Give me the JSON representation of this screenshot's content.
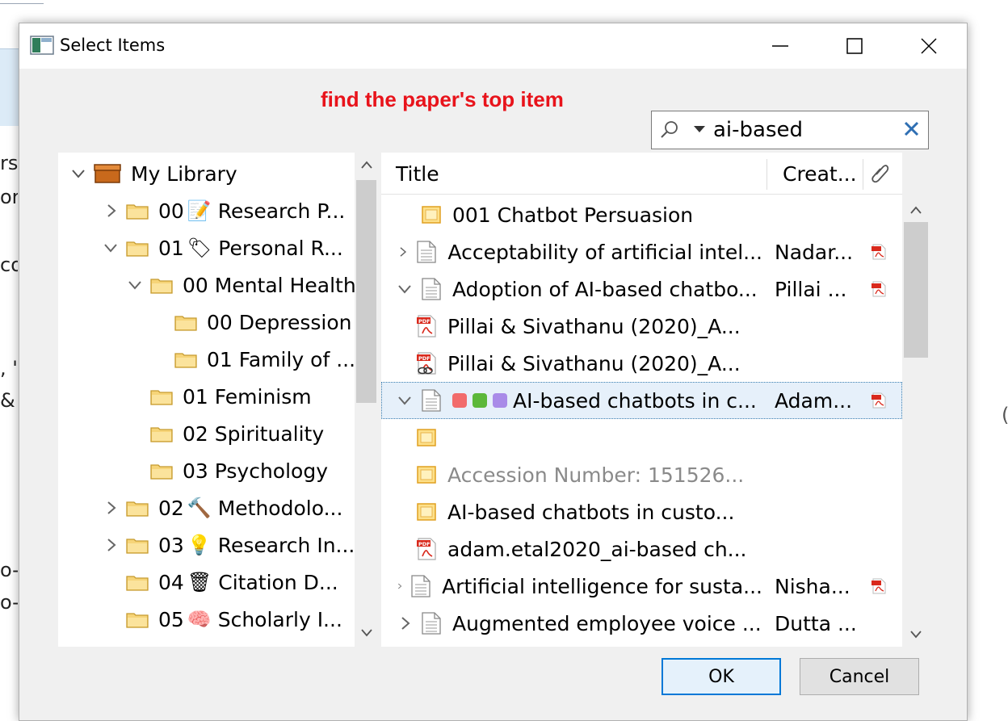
{
  "background_fragments": [
    "rs",
    "or",
    "co",
    ", \"",
    " &",
    "o-",
    "o-"
  ],
  "dialog": {
    "title": "Select Items",
    "instruction": "find the paper's top item"
  },
  "search": {
    "value": "ai-based"
  },
  "tree": {
    "root": "My Library",
    "items": [
      {
        "label": "00",
        "emoji": "📝",
        "name": "Research P...",
        "expander": "collapsed"
      },
      {
        "label": "01",
        "emoji": "🏷",
        "name": "Personal R...",
        "expander": "expanded"
      },
      {
        "label": "00 Mental Health",
        "emoji": "",
        "name": "",
        "expander": "expanded"
      },
      {
        "label": "00 Depression",
        "emoji": "",
        "name": "",
        "expander": "none"
      },
      {
        "label": "01 Family of ...",
        "emoji": "",
        "name": "",
        "expander": "none"
      },
      {
        "label": "01 Feminism",
        "emoji": "",
        "name": "",
        "expander": "none"
      },
      {
        "label": "02 Spirituality",
        "emoji": "",
        "name": "",
        "expander": "none"
      },
      {
        "label": "03 Psychology",
        "emoji": "",
        "name": "",
        "expander": "none"
      },
      {
        "label": "02",
        "emoji": "🔨",
        "name": "Methodolo...",
        "expander": "collapsed"
      },
      {
        "label": "03",
        "emoji": "💡",
        "name": "Research In...",
        "expander": "collapsed"
      },
      {
        "label": "04",
        "emoji": "🗑",
        "name": "Citation D...",
        "expander": "none"
      },
      {
        "label": "05",
        "emoji": "🧠",
        "name": "Scholarly I...",
        "expander": "none"
      }
    ]
  },
  "list": {
    "columns": {
      "title": "Title",
      "creator": "Creat..."
    },
    "rows": [
      {
        "title": "001 Chatbot Persuasion",
        "creator": "",
        "kind": "note",
        "expander": "none",
        "indent": 0,
        "pdf": false
      },
      {
        "title": "Acceptability of artificial intel...",
        "creator": "Nadar...",
        "kind": "doc",
        "expander": "collapsed",
        "indent": 0,
        "pdf": true
      },
      {
        "title": "Adoption of AI-based chatbo...",
        "creator": "Pillai ...",
        "kind": "doc",
        "expander": "expanded",
        "indent": 0,
        "pdf": true
      },
      {
        "title": "Pillai & Sivathanu (2020)_A...",
        "creator": "",
        "kind": "pdf",
        "expander": "none",
        "indent": 1,
        "pdf": false
      },
      {
        "title": "Pillai & Sivathanu (2020)_A...",
        "creator": "",
        "kind": "pdf-link",
        "expander": "none",
        "indent": 1,
        "pdf": false
      },
      {
        "title": "AI-based chatbots in c...",
        "creator": "Adam...",
        "kind": "doc",
        "expander": "expanded",
        "indent": 0,
        "pdf": true,
        "tags": [
          "#f26b6b",
          "#5cb83a",
          "#a98be8"
        ],
        "selected": true
      },
      {
        "title": "",
        "creator": "",
        "kind": "note",
        "expander": "none",
        "indent": 1,
        "pdf": false
      },
      {
        "title": "Accession Number: 151526...",
        "creator": "",
        "kind": "note",
        "expander": "none",
        "indent": 1,
        "pdf": false,
        "muted": true
      },
      {
        "title": "AI-based chatbots in custo...",
        "creator": "",
        "kind": "note",
        "expander": "none",
        "indent": 1,
        "pdf": false
      },
      {
        "title": "adam.etal2020_ai-based ch...",
        "creator": "",
        "kind": "pdf",
        "expander": "none",
        "indent": 1,
        "pdf": false
      },
      {
        "title": "Artificial intelligence for susta...",
        "creator": "Nisha...",
        "kind": "doc",
        "expander": "collapsed",
        "indent": 0,
        "pdf": true
      },
      {
        "title": "Augmented employee voice ...",
        "creator": "Dutta ...",
        "kind": "doc",
        "expander": "collapsed",
        "indent": 0,
        "pdf": false
      }
    ]
  },
  "buttons": {
    "ok": "OK",
    "cancel": "Cancel"
  }
}
